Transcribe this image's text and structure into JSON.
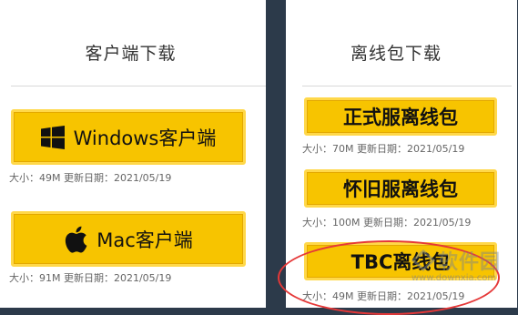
{
  "left_panel": {
    "title": "客户端下载",
    "windows_button": {
      "label": "Windows客户端",
      "icon": "windows-logo-icon"
    },
    "windows_info": "大小：49M 更新日期：2021/05/19",
    "mac_button": {
      "label": "Mac客户端",
      "icon": "apple-logo-icon"
    },
    "mac_info": "大小：91M 更新日期：2021/05/19"
  },
  "right_panel": {
    "title": "离线包下载",
    "items": [
      {
        "label": "正式服离线包",
        "info": "大小：70M 更新日期：2021/05/19"
      },
      {
        "label": "怀旧服离线包",
        "info": "大小：100M 更新日期：2021/05/19"
      },
      {
        "label": "TBC离线包",
        "info": "大小：49M 更新日期：2021/05/19"
      }
    ]
  },
  "watermark": {
    "text": "软件园",
    "url": "www.downxia.com"
  },
  "colors": {
    "button": "#f7c400",
    "highlight": "#e53838",
    "background": "#2c3a4a"
  }
}
